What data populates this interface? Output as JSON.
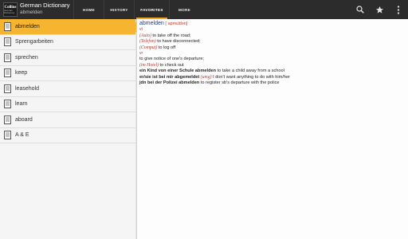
{
  "app": {
    "logo_line1": "Collins",
    "logo_line2": "German Dictionary",
    "title": "German Dictionary",
    "subtitle": "abmelden"
  },
  "tabs": [
    {
      "label": "HOME",
      "active": false
    },
    {
      "label": "HISTORY",
      "active": false
    },
    {
      "label": "FAVORITES",
      "active": true
    },
    {
      "label": "MORE",
      "active": false
    }
  ],
  "actions": [
    {
      "icon": "search-icon"
    },
    {
      "icon": "star-icon"
    },
    {
      "icon": "overflow-menu-icon"
    }
  ],
  "favorites": [
    {
      "label": "abmelden",
      "selected": true
    },
    {
      "label": "Sprengarbeiten",
      "selected": false
    },
    {
      "label": "sprechen",
      "selected": false
    },
    {
      "label": "keep",
      "selected": false
    },
    {
      "label": "leasehold",
      "selected": false
    },
    {
      "label": "learn",
      "selected": false
    },
    {
      "label": "aboard",
      "selected": false
    },
    {
      "label": "A & E",
      "selected": false
    }
  ],
  "entry": {
    "headword": "abmelden",
    "pronunciation": "[ˈapmɛldən]",
    "sense1": {
      "pos": "vt",
      "lines": [
        {
          "label": "(Auto)",
          "text": " to take off the road;"
        },
        {
          "label": "(Telefon)",
          "text": " to have disconnected;"
        },
        {
          "label": "(Comput)",
          "text": " to log off"
        }
      ]
    },
    "sense2": {
      "pos": "vr",
      "line1": "to give notice of one's departure;",
      "line2_label": "(im Hotel)",
      "line2_text": " to check out"
    },
    "examples": [
      {
        "bold": "ein Kind von einer Schule abmelden",
        "label": "",
        "text": " to take a child away from a school"
      },
      {
        "bold": "er/sie ist bei mir abgemeldet",
        "label": " (umg)",
        "text": " I don't want anything to do with him/her"
      },
      {
        "bold": "jdn bei der Polizei abmelden",
        "label": "",
        "text": " to register sb's departure with the police"
      }
    ]
  },
  "colors": {
    "topbar": "#2c2c2c",
    "accent": "#f6b531",
    "headword": "#1c3f8a",
    "label": "#b03a2e"
  }
}
